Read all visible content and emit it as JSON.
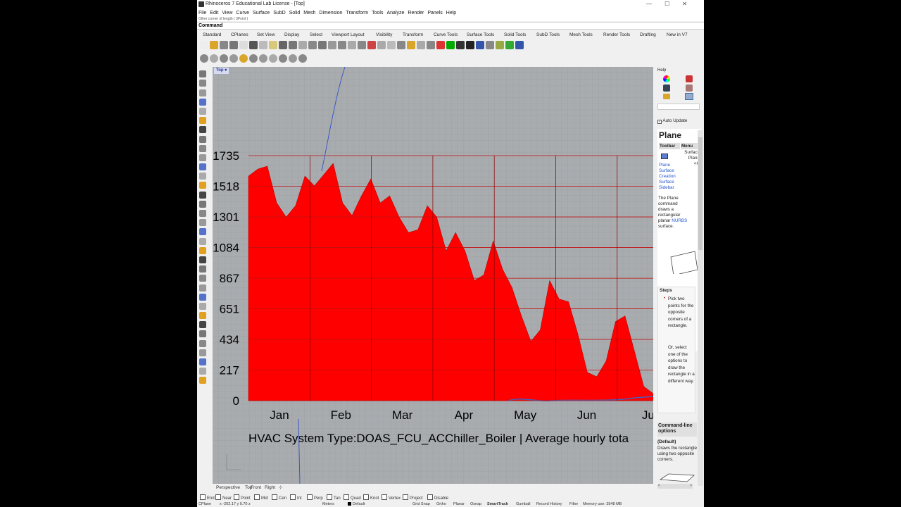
{
  "window": {
    "title": "Rhinoceros 7 Educational Lab License - [Top]",
    "controls": [
      "—",
      "☐",
      "✕"
    ]
  },
  "menu": [
    "File",
    "Edit",
    "View",
    "Curve",
    "Surface",
    "SubD",
    "Solid",
    "Mesh",
    "Dimension",
    "Transform",
    "Tools",
    "Analyze",
    "Render",
    "Panels",
    "Help"
  ],
  "history_text": "Other corner of length ( 3Point )",
  "command": {
    "label": "Command:",
    "value": ""
  },
  "toolbar_tabs": [
    "Standard",
    "CPlanes",
    "Set View",
    "Display",
    "Select",
    "Viewport Layout",
    "Visibility",
    "Transform",
    "Curve Tools",
    "Surface Tools",
    "Solid Tools",
    "SubD Tools",
    "Mesh Tools",
    "Render Tools",
    "Drafting",
    "New in V7"
  ],
  "viewport": {
    "name": "Top",
    "menu_arrow": "▾"
  },
  "viewport_tabs": [
    "Perspective",
    "Top",
    "Front",
    "Right",
    "⊹"
  ],
  "osnaps": [
    "End",
    "Near",
    "Point",
    "Mid",
    "Cen",
    "Int",
    "Perp",
    "Tan",
    "Quad",
    "Knot",
    "Vertex",
    "Project",
    "Disable"
  ],
  "status": {
    "cplane": "CPlane",
    "coords": "x -202.17   y 0.70   z",
    "units": "Meters",
    "layer": "Default",
    "toggles": [
      "Grid Snap",
      "Ortho",
      "Planar",
      "Osnap",
      "SmartTrack",
      "Gumball",
      "Record History",
      "Filter"
    ],
    "memory": "Memory use: 3548 MB"
  },
  "panel": {
    "help_label": "Help",
    "auto_update": "Auto Update",
    "title": "Plane",
    "col_toolbar": "Toolbar",
    "col_menu": "Menu",
    "menu_path": "Surface\nPlane\n<C",
    "toolbar_path": [
      "Plane",
      "Surface",
      "Creation",
      "Surface",
      "Sidebar"
    ],
    "desc_1": "The Plane",
    "desc_2": "command",
    "desc_3": "draws a",
    "desc_4": "rectangular",
    "desc_5": "planar",
    "desc_nurbs": "NURBS",
    "desc_6": "surface.",
    "steps_label": "Steps",
    "step1": "Pick two points for the opposite corners of a rectangle.",
    "step2": "Or, select one of the options to draw the rectangle in a different way.",
    "cmdline_label": "Command-line options",
    "default_label": "(Default)",
    "default_text": "Draws the rectangle using two opposite corners."
  },
  "colors": {
    "area_fill": "#ff0000",
    "grid_line": "#c01010",
    "viewport_bg": "#a9acaf",
    "label_bg": "#d6dbf2"
  },
  "chart_data": {
    "type": "area",
    "title": "HVAC System Type:DOAS_FCU_ACChiller_Boiler | Average hourly tota",
    "xlabel": "",
    "ylabel": "",
    "ylim": [
      0,
      1735
    ],
    "yticks": [
      "0",
      "217",
      "434",
      "651",
      "867",
      "1084",
      "1301",
      "1518",
      "1735"
    ],
    "categories": [
      "Jan",
      "Feb",
      "Mar",
      "Apr",
      "May",
      "Jun",
      "Ju"
    ],
    "series": [
      {
        "values": [
          1590,
          1640,
          1660,
          1400,
          1300,
          1380,
          1590,
          1520,
          1600,
          1680,
          1400,
          1310,
          1450,
          1570,
          1400,
          1450,
          1300,
          1190,
          1210,
          1380,
          1300,
          1060,
          1190,
          1060,
          850,
          890,
          1130,
          930,
          800,
          600,
          420,
          500,
          850,
          720,
          700,
          470,
          200,
          170,
          280,
          560,
          600,
          350,
          100,
          50
        ]
      }
    ]
  }
}
